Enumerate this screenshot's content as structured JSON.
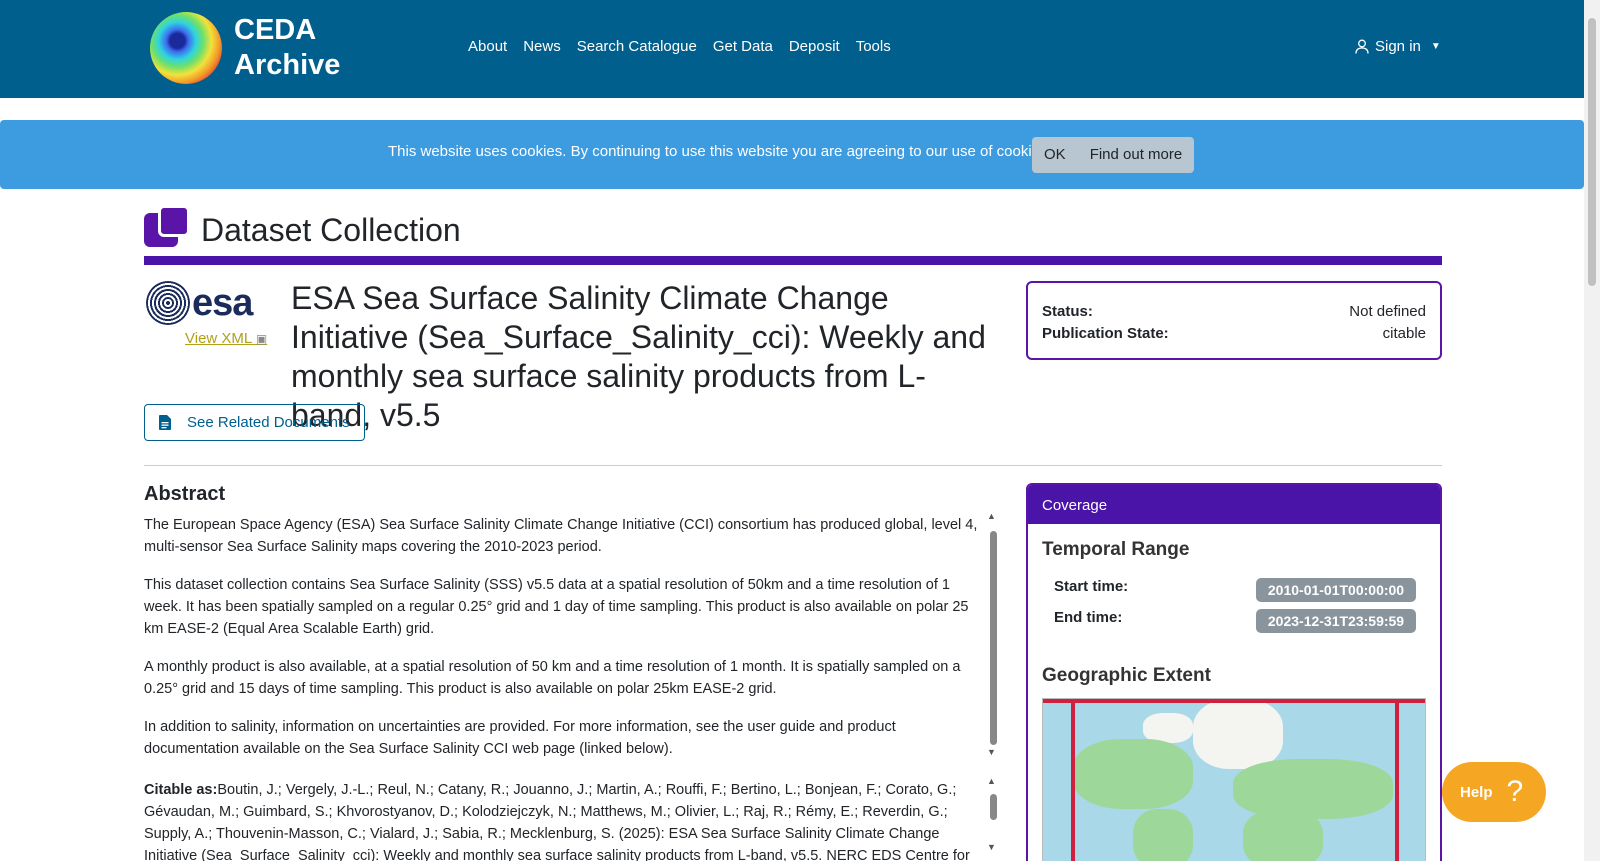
{
  "header": {
    "logo_line1": "CEDA",
    "logo_line2": "Archive",
    "nav": [
      "About",
      "News",
      "Search Catalogue",
      "Get Data",
      "Deposit",
      "Tools"
    ],
    "signin": "Sign in"
  },
  "cookie": {
    "text": "This website uses cookies. By continuing to use this website you are agreeing to our use of cookies.",
    "ok": "OK",
    "find_out_more": "Find out more"
  },
  "page": {
    "section_title": "Dataset Collection",
    "logo_text": "esa",
    "view_xml": "View XML",
    "title": "ESA Sea Surface Salinity Climate Change Initiative (Sea_Surface_Salinity_cci): Weekly and monthly sea surface salinity products from L-band, v5.5",
    "related_docs": "See Related Documents"
  },
  "status": {
    "status_label": "Status:",
    "status_value": "Not defined",
    "pub_label": "Publication State:",
    "pub_value": "citable"
  },
  "abstract": {
    "heading": "Abstract",
    "p1": "The European Space Agency (ESA) Sea Surface Salinity Climate Change Initiative (CCI) consortium has produced global, level 4, multi-sensor Sea Surface Salinity maps covering the 2010-2023 period.",
    "p2": "This dataset collection contains Sea Surface Salinity (SSS) v5.5 data at a spatial resolution of 50km and a time resolution of 1 week. It has been spatially sampled on a regular 0.25° grid and 1 day of time sampling. This product is also available on polar 25 km EASE-2 (Equal Area Scalable Earth) grid.",
    "p3": "A monthly product is also available, at a spatial resolution of 50 km and a time resolution of 1 month. It is spatially sampled on a 0.25° grid and 15 days of time sampling. This product is also available on polar 25km EASE-2 grid.",
    "p4": "In addition to salinity, information on uncertainties are provided. For more information, see the user guide and product documentation available on the Sea Surface Salinity CCI web page (linked below).",
    "cite_label": "Citable as:",
    "cite_text": "Boutin, J.; Vergely, J.-L.; Reul, N.; Catany, R.; Jouanno, J.; Martin, A.; Rouffi, F.; Bertino, L.; Bonjean, F.; Corato, G.; Gévaudan, M.; Guimbard, S.; Khvorostyanov, D.; Kolodziejczyk, N.; Matthews, M.; Olivier, L.; Raj, R.; Rémy, E.; Reverdin, G.; Supply, A.; Thouvenin-Masson, C.; Vialard, J.; Sabia, R.; Mecklenburg, S. (2025): ESA Sea Surface Salinity Climate Change Initiative (Sea_Surface_Salinity_cci): Weekly and monthly sea surface salinity products from L-band, v5.5. NERC EDS Centre for"
  },
  "coverage": {
    "heading": "Coverage",
    "temporal": "Temporal Range",
    "start_label": "Start time:",
    "start_value": "2010-01-01T00:00:00",
    "end_label": "End time:",
    "end_value": "2023-12-31T23:59:59",
    "geo": "Geographic Extent"
  },
  "help": {
    "label": "Help",
    "icon": "?"
  },
  "colors": {
    "navbar": "#005f8c",
    "cookie": "#3d9be0",
    "accent": "#4b14a8",
    "help": "#f5a623"
  }
}
